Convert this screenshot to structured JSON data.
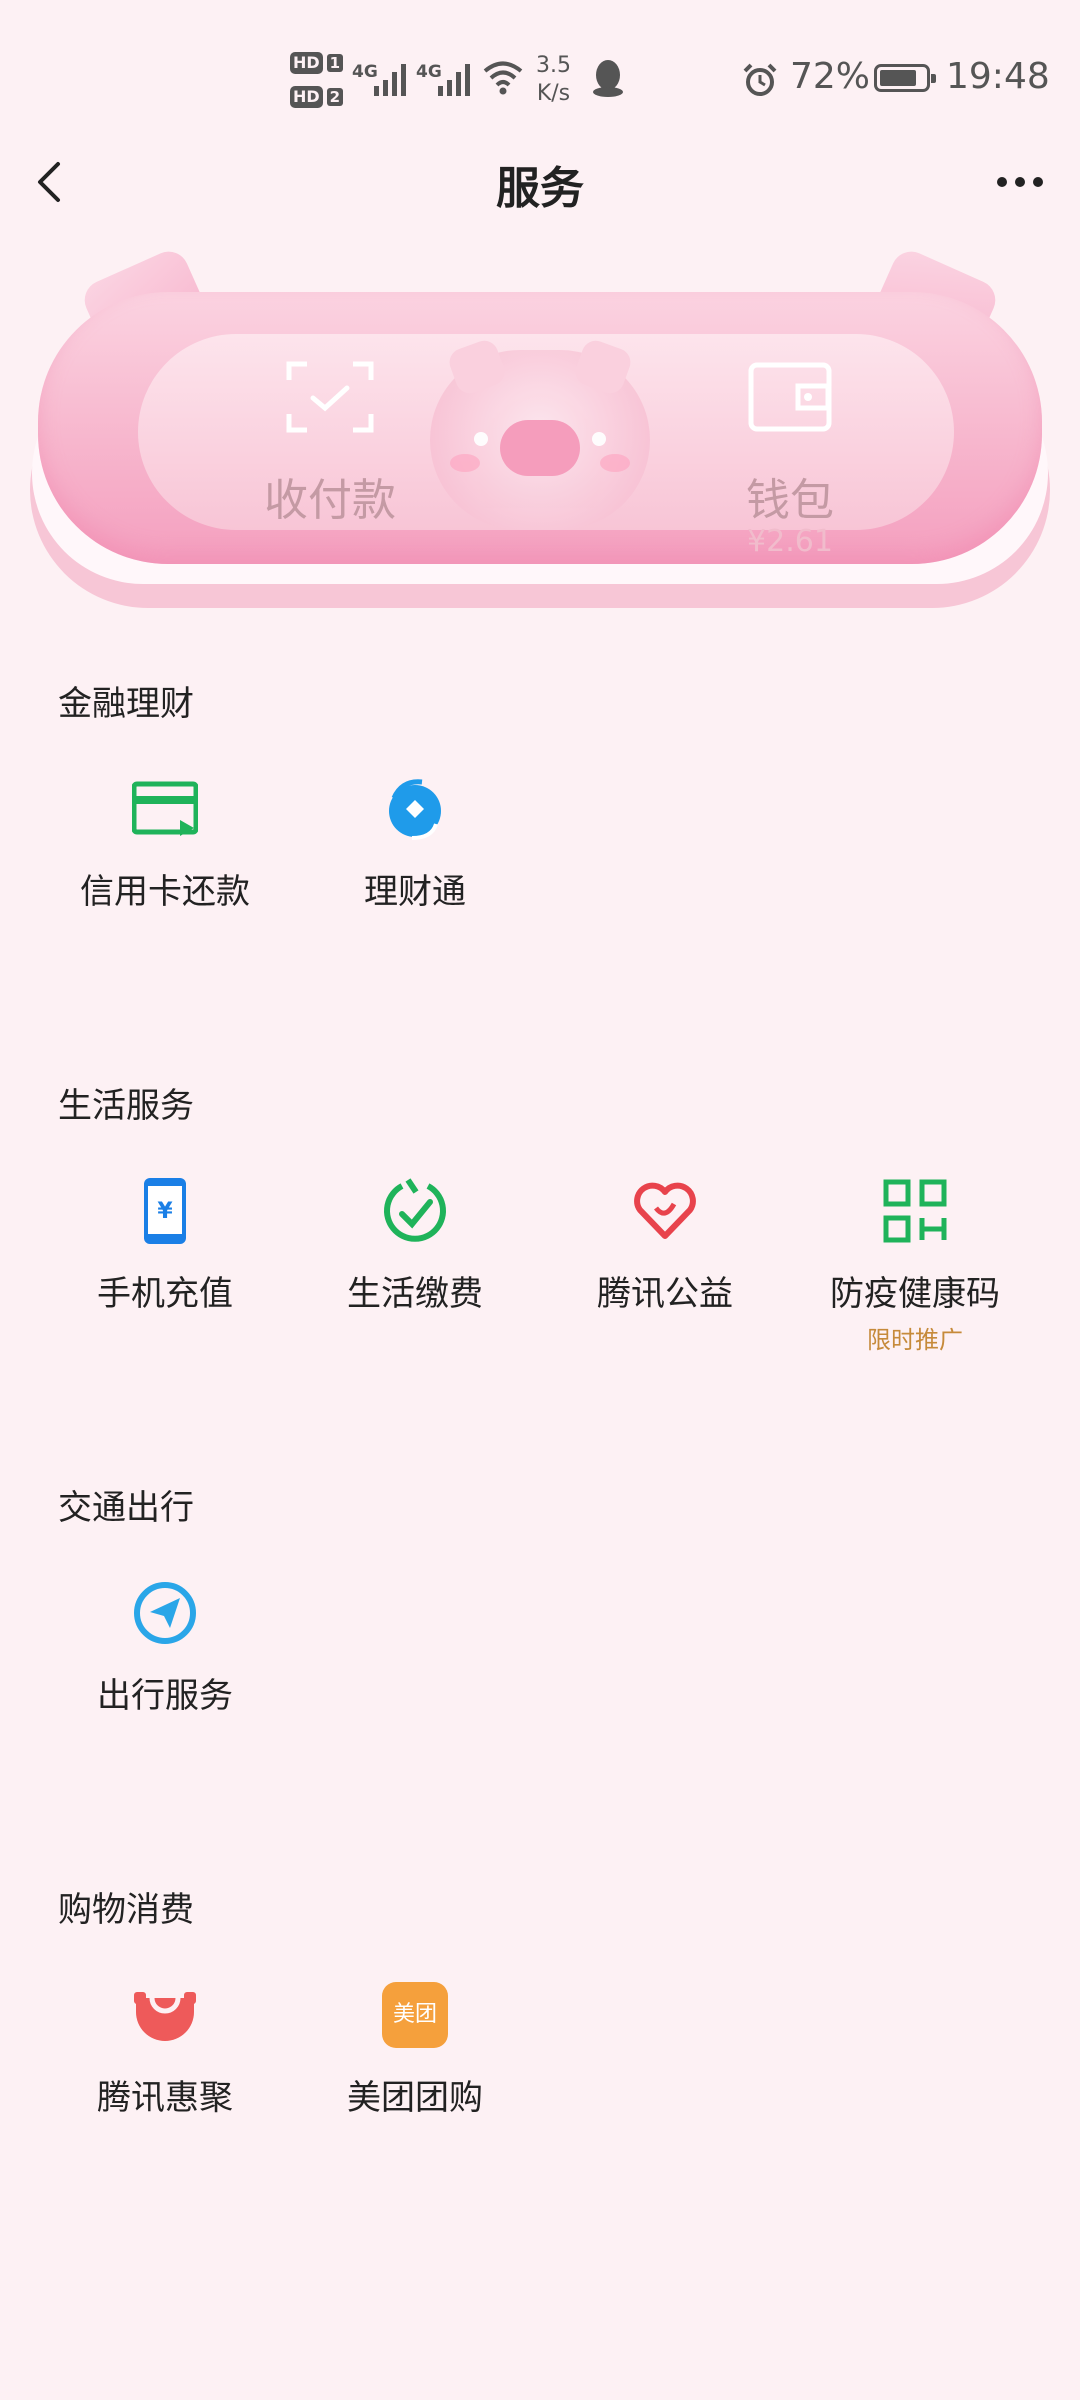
{
  "status_bar": {
    "hd1": "HD",
    "sim1": "1",
    "hd2": "HD",
    "sim2": "2",
    "net1": "4G",
    "net2": "4G",
    "speed_value": "3.5",
    "speed_unit": "K/s",
    "battery": "72%",
    "time": "19:48",
    "icons": [
      "signal-icon",
      "wifi-icon",
      "qq-icon",
      "alarm-icon",
      "battery-icon"
    ]
  },
  "header": {
    "title": "服务",
    "back_icon": "back-chevron-icon",
    "more_icon": "more-dots-icon"
  },
  "banner": {
    "pay_label": "收付款",
    "wallet_label": "钱包",
    "wallet_amount": "¥2.61"
  },
  "sections": [
    {
      "title": "金融理财",
      "items": [
        {
          "label": "信用卡还款",
          "icon": "credit-card-icon",
          "color": "#1fb35a"
        },
        {
          "label": "理财通",
          "icon": "wealth-icon",
          "color": "#1f9bea"
        }
      ]
    },
    {
      "title": "生活服务",
      "items": [
        {
          "label": "手机充值",
          "icon": "phone-recharge-icon",
          "color": "#1a7fe6"
        },
        {
          "label": "生活缴费",
          "icon": "bill-check-icon",
          "color": "#1fb35a"
        },
        {
          "label": "腾讯公益",
          "icon": "charity-heart-icon",
          "color": "#e8434c"
        },
        {
          "label": "防疫健康码",
          "icon": "qr-code-icon",
          "color": "#1fb35a",
          "sub": "限时推广"
        }
      ]
    },
    {
      "title": "交通出行",
      "items": [
        {
          "label": "出行服务",
          "icon": "navigation-icon",
          "color": "#2aa6e8"
        }
      ]
    },
    {
      "title": "购物消费",
      "items": [
        {
          "label": "腾讯惠聚",
          "icon": "shopping-bag-icon",
          "color": "#ee5a5a"
        },
        {
          "label": "美团团购",
          "icon": "meituan-icon",
          "color": "#f5a03c",
          "icon_text": "美团"
        }
      ]
    }
  ]
}
